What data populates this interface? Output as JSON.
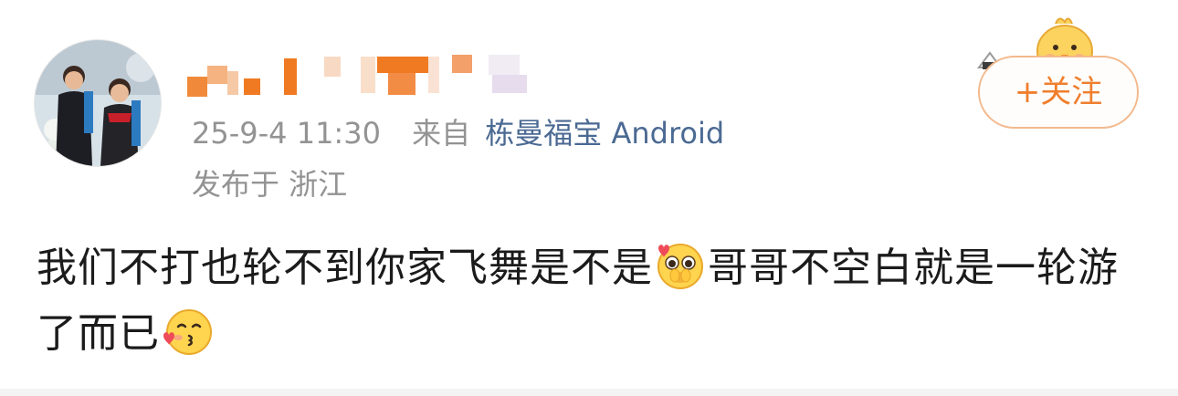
{
  "post": {
    "time": "25-9-4 11:30",
    "source_prefix": "来自",
    "source_name": "栋曼福宝 Android",
    "location": "发布于 浙江",
    "text_part1": "我们不打也轮不到你家飞舞是不是",
    "text_part2": "哥哥不空白就是一轮游了而已"
  },
  "follow_button": {
    "label": "+关注"
  },
  "emoji": {
    "first": "pleading-face-icon",
    "second": "kissing-face-icon"
  },
  "colors": {
    "follow_orange": "#ef7e2d",
    "follow_border": "#f2b98d",
    "link_blue": "#4b6a93",
    "meta_gray": "#939393"
  }
}
